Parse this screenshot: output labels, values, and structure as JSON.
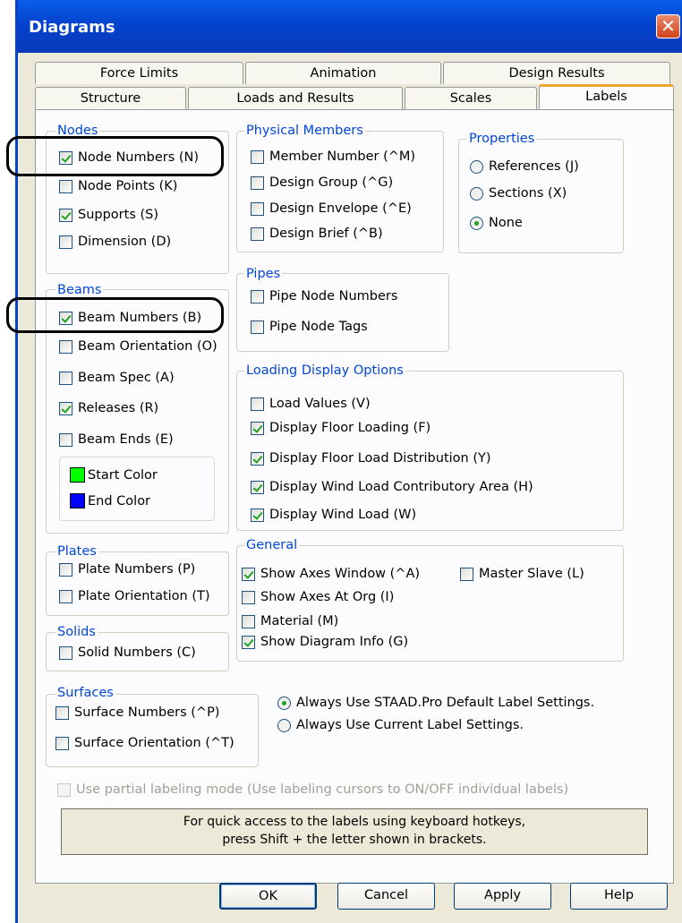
{
  "window": {
    "title": "Diagrams",
    "close_glyph": "✕"
  },
  "tabs": {
    "row1": [
      "Force Limits",
      "Animation",
      "Design Results"
    ],
    "row2": [
      "Structure",
      "Loads and Results",
      "Scales",
      "Labels"
    ],
    "active": "Labels"
  },
  "nodes": {
    "title": "Nodes",
    "items": [
      {
        "label": "Node Numbers (N)",
        "checked": true
      },
      {
        "label": "Node Points (K)",
        "checked": false
      },
      {
        "label": "Supports (S)",
        "checked": true
      },
      {
        "label": "Dimension (D)",
        "checked": false
      }
    ]
  },
  "beams": {
    "title": "Beams",
    "items": [
      {
        "label": "Beam Numbers (B)",
        "checked": true
      },
      {
        "label": "Beam Orientation (O)",
        "checked": false
      },
      {
        "label": "Beam Spec (A)",
        "checked": false
      },
      {
        "label": "Releases (R)",
        "checked": true
      },
      {
        "label": "Beam Ends (E)",
        "checked": false
      }
    ],
    "start_color_label": "Start Color",
    "end_color_label": "End Color",
    "start_color": "#00ff00",
    "end_color": "#0000ff"
  },
  "plates": {
    "title": "Plates",
    "items": [
      {
        "label": "Plate Numbers (P)",
        "checked": false
      },
      {
        "label": "Plate Orientation (T)",
        "checked": false
      }
    ]
  },
  "solids": {
    "title": "Solids",
    "items": [
      {
        "label": "Solid Numbers (C)",
        "checked": false
      }
    ]
  },
  "surfaces": {
    "title": "Surfaces",
    "items": [
      {
        "label": "Surface Numbers (^P)",
        "checked": false
      },
      {
        "label": "Surface Orientation (^T)",
        "checked": false
      }
    ]
  },
  "physical_members": {
    "title": "Physical Members",
    "items": [
      {
        "label": "Member Number (^M)",
        "checked": false
      },
      {
        "label": "Design Group (^G)",
        "checked": false
      },
      {
        "label": "Design Envelope (^E)",
        "checked": false
      },
      {
        "label": "Design Brief (^B)",
        "checked": false
      }
    ]
  },
  "properties": {
    "title": "Properties",
    "options": [
      {
        "label": "References (J)",
        "selected": false
      },
      {
        "label": "Sections (X)",
        "selected": false
      },
      {
        "label": "None",
        "selected": true
      }
    ]
  },
  "pipes": {
    "title": "Pipes",
    "items": [
      {
        "label": "Pipe Node Numbers",
        "checked": false
      },
      {
        "label": "Pipe Node Tags",
        "checked": false
      }
    ]
  },
  "loading": {
    "title": "Loading Display Options",
    "items": [
      {
        "label": "Load Values (V)",
        "checked": false
      },
      {
        "label": "Display Floor Loading (F)",
        "checked": true
      },
      {
        "label": "Display Floor Load Distribution (Y)",
        "checked": true
      },
      {
        "label": "Display Wind Load Contributory Area (H)",
        "checked": true
      },
      {
        "label": "Display Wind Load (W)",
        "checked": true
      }
    ]
  },
  "general": {
    "title": "General",
    "items": [
      {
        "label": "Show Axes Window (^A)",
        "checked": true
      },
      {
        "label": "Show Axes At Org (I)",
        "checked": false
      },
      {
        "label": "Material (M)",
        "checked": false
      },
      {
        "label": "Show Diagram Info (G)",
        "checked": true
      },
      {
        "label": "Master Slave (L)",
        "checked": false
      }
    ]
  },
  "label_settings": {
    "options": [
      {
        "label": "Always Use STAAD.Pro Default Label Settings.",
        "selected": true
      },
      {
        "label": "Always Use Current Label Settings.",
        "selected": false
      }
    ]
  },
  "partial": {
    "label": "Use partial labeling mode (Use labeling cursors to ON/OFF individual labels)",
    "checked": false,
    "enabled": false
  },
  "info": {
    "line1": "For quick access to the labels using keyboard hotkeys,",
    "line2": "press Shift + the letter shown in brackets."
  },
  "buttons": {
    "ok": "OK",
    "cancel": "Cancel",
    "apply": "Apply",
    "help": "Help"
  }
}
